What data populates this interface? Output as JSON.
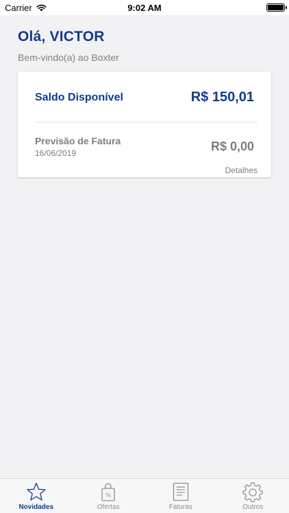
{
  "status_bar": {
    "carrier": "Carrier",
    "time": "9:02 AM"
  },
  "greeting": {
    "title": "Olá, VICTOR",
    "subtitle": "Bem-vindo(a) ao Boxter"
  },
  "balance_card": {
    "saldo_label": "Saldo Disponível",
    "saldo_value": "R$ 150,01",
    "previsao_label": "Previsão de Fatura",
    "previsao_date": "16/06/2019",
    "previsao_value": "R$ 0,00",
    "details_link": "Detalhes"
  },
  "tab_bar": {
    "tabs": [
      {
        "label": "Novidades",
        "icon": "star-icon",
        "active": true
      },
      {
        "label": "Ofertas",
        "icon": "shopping-bag-icon",
        "active": false
      },
      {
        "label": "Faturas",
        "icon": "invoice-icon",
        "active": false
      },
      {
        "label": "Outros",
        "icon": "gear-icon",
        "active": false
      }
    ]
  },
  "colors": {
    "brand_blue": "#123b8a",
    "muted_gray": "#7d7d7d",
    "background": "#f2f2f4"
  }
}
